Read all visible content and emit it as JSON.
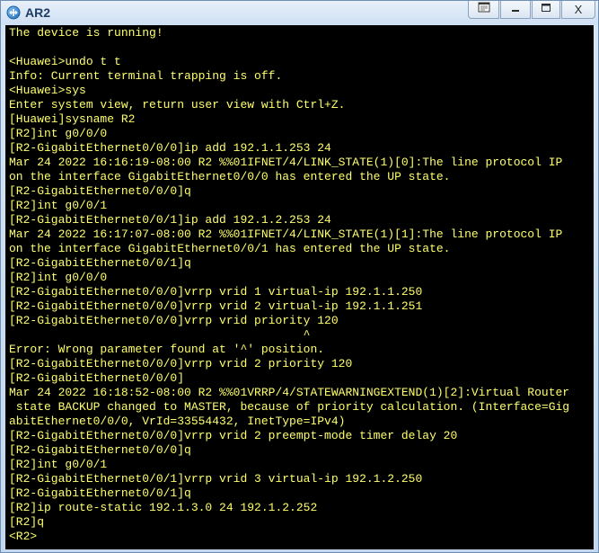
{
  "window": {
    "title": "AR2",
    "icons": {
      "app": "router-app-icon",
      "restore": "restore-icon",
      "minimize": "minimize-icon",
      "maximize": "maximize-icon",
      "close": "close-icon"
    },
    "close_label": "X"
  },
  "colors": {
    "terminal_background": "#000000",
    "terminal_text": "#ffff6b",
    "title_text": "#1d3c66"
  },
  "terminal": {
    "lines": [
      "The device is running!",
      "",
      "<Huawei>undo t t",
      "Info: Current terminal trapping is off.",
      "<Huawei>sys",
      "Enter system view, return user view with Ctrl+Z.",
      "[Huawei]sysname R2",
      "[R2]int g0/0/0",
      "[R2-GigabitEthernet0/0/0]ip add 192.1.1.253 24",
      "Mar 24 2022 16:16:19-08:00 R2 %%01IFNET/4/LINK_STATE(1)[0]:The line protocol IP",
      "on the interface GigabitEthernet0/0/0 has entered the UP state.",
      "[R2-GigabitEthernet0/0/0]q",
      "[R2]int g0/0/1",
      "[R2-GigabitEthernet0/0/1]ip add 192.1.2.253 24",
      "Mar 24 2022 16:17:07-08:00 R2 %%01IFNET/4/LINK_STATE(1)[1]:The line protocol IP",
      "on the interface GigabitEthernet0/0/1 has entered the UP state.",
      "[R2-GigabitEthernet0/0/1]q",
      "[R2]int g0/0/0",
      "[R2-GigabitEthernet0/0/0]vrrp vrid 1 virtual-ip 192.1.1.250",
      "[R2-GigabitEthernet0/0/0]vrrp vrid 2 virtual-ip 192.1.1.251",
      "[R2-GigabitEthernet0/0/0]vrrp vrid priority 120",
      "                                          ^",
      "Error: Wrong parameter found at '^' position.",
      "[R2-GigabitEthernet0/0/0]vrrp vrid 2 priority 120",
      "[R2-GigabitEthernet0/0/0]",
      "Mar 24 2022 16:18:52-08:00 R2 %%01VRRP/4/STATEWARNINGEXTEND(1)[2]:Virtual Router",
      " state BACKUP changed to MASTER, because of priority calculation. (Interface=Gig",
      "abitEthernet0/0/0, VrId=33554432, InetType=IPv4)",
      "[R2-GigabitEthernet0/0/0]vrrp vrid 2 preempt-mode timer delay 20",
      "[R2-GigabitEthernet0/0/0]q",
      "[R2]int g0/0/1",
      "[R2-GigabitEthernet0/0/1]vrrp vrid 3 virtual-ip 192.1.2.250",
      "[R2-GigabitEthernet0/0/1]q",
      "[R2]ip route-static 192.1.3.0 24 192.1.2.252",
      "[R2]q",
      "<R2>"
    ]
  }
}
